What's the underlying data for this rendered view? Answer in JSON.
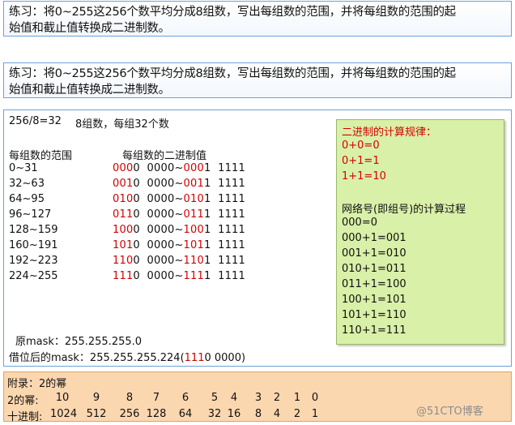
{
  "exercise": {
    "line1": "练习：将0~255这256个数平均分成8组数，写出每组数的范围，并将每组数的范围的起",
    "line2": "始值和截止值转换成二进制数。"
  },
  "main": {
    "summary_left": "256/8=32",
    "summary_right": "8组数，每组32个数",
    "col_range_header": "每组数的范围",
    "col_binary_header": "每组数的二进制值",
    "rows": [
      {
        "range": "0~31",
        "s_red": "000",
        "s_mid": "0  0000~",
        "e_red": "000",
        "e_rest": "1  1111"
      },
      {
        "range": "32~63",
        "s_red": "001",
        "s_mid": "0  0000~",
        "e_red": "001",
        "e_rest": "1  1111"
      },
      {
        "range": "64~95",
        "s_red": "010",
        "s_mid": "0  0000~",
        "e_red": "010",
        "e_rest": "1  1111"
      },
      {
        "range": "96~127",
        "s_red": "011",
        "s_mid": "0  0000~",
        "e_red": "011",
        "e_rest": "1  1111"
      },
      {
        "range": "128~159",
        "s_red": "100",
        "s_mid": "0  0000~",
        "e_red": "100",
        "e_rest": "1  1111"
      },
      {
        "range": "160~191",
        "s_red": "101",
        "s_mid": "0  0000~",
        "e_red": "101",
        "e_rest": "1  1111"
      },
      {
        "range": "192~223",
        "s_red": "110",
        "s_mid": "0  0000~",
        "e_red": "110",
        "e_rest": "1  1111"
      },
      {
        "range": "224~255",
        "s_red": "111",
        "s_mid": "0  0000~",
        "e_red": "111",
        "e_rest": "1  1111"
      }
    ],
    "orig_mask": "原mask：255.255.255.0",
    "new_mask_prefix": "借位后的mask：255.255.255.224(",
    "new_mask_red": "111",
    "new_mask_suffix": "0  0000)"
  },
  "rules": {
    "title": "二进制的计算规律：",
    "add_rules": [
      "0+0=0",
      "0+1=1",
      "1+1=10"
    ],
    "net_title": "网络号(即组号)的计算过程",
    "net_steps": [
      "000=0",
      "000+1=001",
      "001+1=010",
      "010+1=011",
      "011+1=100",
      "100+1=101",
      "101+1=110",
      "110+1=111"
    ]
  },
  "appendix": {
    "title": "附录：2的幂",
    "power_label": "2的幂:",
    "powers": [
      "10",
      "9",
      "8",
      "7",
      "6",
      "5",
      "4",
      "3",
      "2",
      "1",
      "0"
    ],
    "decimal_label": "十进制:",
    "decimals": [
      "1024",
      "512",
      "256",
      "128",
      "64",
      "32",
      "16",
      "8",
      "4",
      "2",
      "1"
    ]
  },
  "watermark": "@51CTO博客",
  "colors": {
    "highlight_red": "#d40000",
    "rules_bg": "#d9f0a8",
    "appendix_bg": "#fbd7b0",
    "border_blue": "#6fa0d8"
  }
}
